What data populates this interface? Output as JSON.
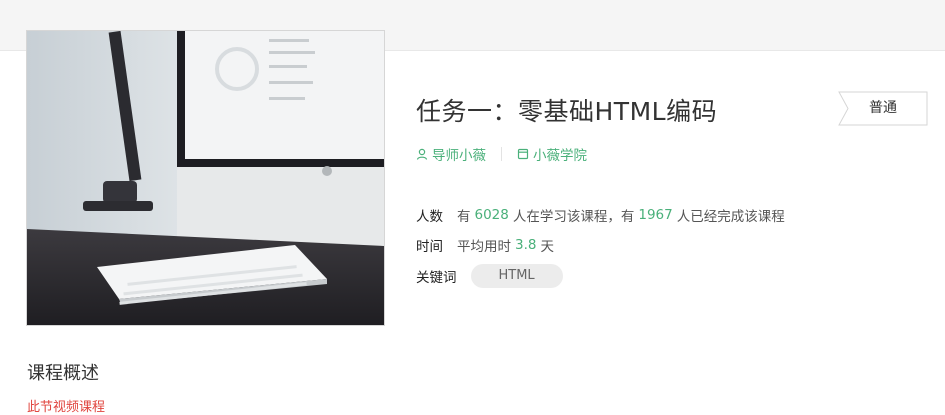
{
  "course": {
    "title": "任务一：零基础HTML编码",
    "badge": "普通",
    "tutor": "导师小薇",
    "school": "小薇学院",
    "stats": {
      "people_label": "人数",
      "people_prefix": "有",
      "learning_count": "6028",
      "learning_mid": "人在学习该课程，有",
      "completed_count": "1967",
      "completed_suffix": "人已经完成该课程",
      "time_label": "时间",
      "time_prefix": "平均用时",
      "time_value": "3.8",
      "time_unit": "天",
      "keyword_label": "关键词",
      "keyword": "HTML"
    }
  },
  "overview": {
    "heading": "课程概述",
    "cut_text": "此节视频课程"
  },
  "colors": {
    "accent_green": "#4ab07a",
    "warning_red": "#e0443e",
    "tag_bg": "#ececec"
  },
  "icons": {
    "tutor": "person-icon",
    "school": "book-icon"
  }
}
